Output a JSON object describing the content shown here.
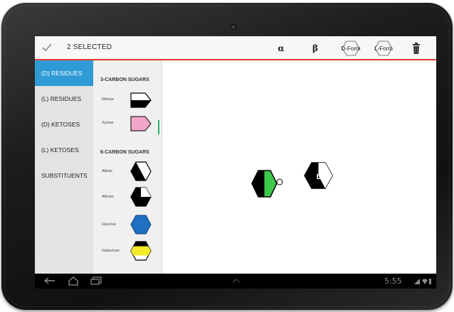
{
  "action_bar": {
    "selected_text": "2 SELECTED",
    "alpha_label": "α",
    "beta_label": "β",
    "dform_label": "D-Form",
    "lform_label": "L-Form",
    "accent_color": "#e53b2e"
  },
  "sidebar": {
    "items": [
      {
        "label": "(D) RESIDUES",
        "active": true
      },
      {
        "label": "(L) RESIDUES",
        "active": false
      },
      {
        "label": "(D) KETOSES",
        "active": false
      },
      {
        "label": "(L) KETOSES",
        "active": false
      },
      {
        "label": "SUBSTITUENTS",
        "active": false
      }
    ],
    "active_color": "#2f9bd6"
  },
  "palette": {
    "sections": [
      {
        "title": "3-CARBON SUGARS",
        "items": [
          {
            "label": "Ribose",
            "shape": "pentagon-black-white",
            "color": "#000000"
          },
          {
            "label": "Xylose",
            "shape": "pentagon-pink",
            "color": "#f4a6c8"
          }
        ]
      },
      {
        "title": "6-CARBON SUGARS",
        "items": [
          {
            "label": "Allose",
            "shape": "hexagon-black-white-diagonal",
            "color": "#000000"
          },
          {
            "label": "Altrose",
            "shape": "hexagon-black-white-quarter",
            "color": "#000000"
          },
          {
            "label": "Glucose",
            "shape": "hexagon-blue",
            "color": "#1f6fc2"
          },
          {
            "label": "Galactose",
            "shape": "hexagon-yellow-band",
            "color": "#f3ea2a"
          }
        ]
      }
    ]
  },
  "canvas": {
    "residues": [
      {
        "name": "green-black-hexagon-residue",
        "color": "#3ec84b",
        "selected": true
      },
      {
        "name": "black-white-hexagon-residue",
        "label": "L",
        "color": "#000000",
        "selected": true
      }
    ]
  },
  "status_bar": {
    "time": "5:55"
  }
}
